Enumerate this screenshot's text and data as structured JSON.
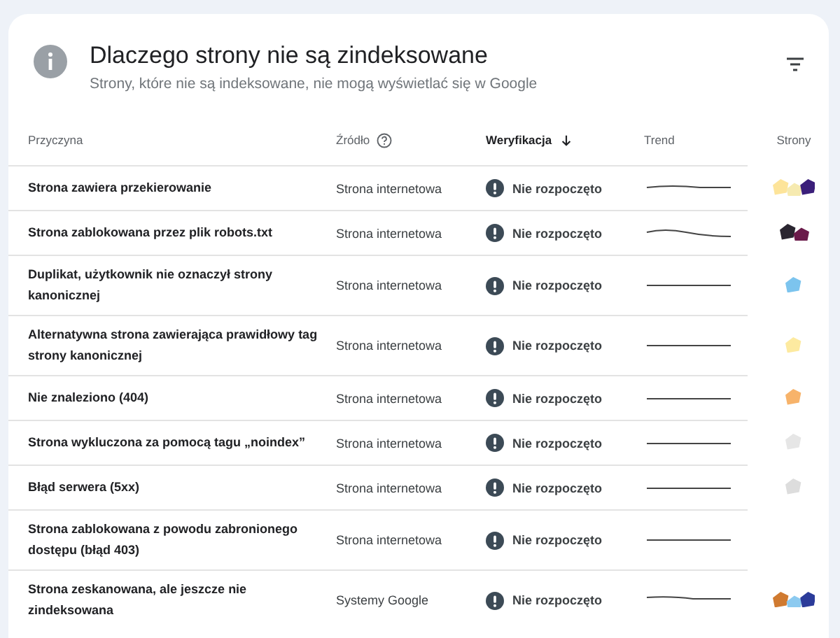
{
  "header": {
    "title": "Dlaczego strony nie są zindeksowane",
    "subtitle": "Strony, które nie są indeksowane, nie mogą wyświetlać się w Google"
  },
  "columns": [
    {
      "label": "Przyczyna",
      "sorted": false,
      "help": false
    },
    {
      "label": "Źródło",
      "sorted": false,
      "help": true
    },
    {
      "label": "Weryfikacja",
      "sorted": true,
      "help": false
    },
    {
      "label": "Trend",
      "sorted": false,
      "help": false
    },
    {
      "label": "Strony",
      "sorted": false,
      "help": false
    }
  ],
  "rows": [
    {
      "reason": "Strona zawiera przekierowanie",
      "source": "Strona internetowa",
      "verification": "Nie rozpoczęto"
    },
    {
      "reason": "Strona zablokowana przez plik robots.txt",
      "source": "Strona internetowa",
      "verification": "Nie rozpoczęto"
    },
    {
      "reason": "Duplikat, użytkownik nie oznaczył strony kanonicznej",
      "source": "Strona internetowa",
      "verification": "Nie rozpoczęto"
    },
    {
      "reason": "Alternatywna strona zawierająca prawidłowy tag strony kanonicznej",
      "source": "Strona internetowa",
      "verification": "Nie rozpoczęto"
    },
    {
      "reason": "Nie znaleziono (404)",
      "source": "Strona internetowa",
      "verification": "Nie rozpoczęto"
    },
    {
      "reason": "Strona wykluczona za pomocą tagu „noindex”",
      "source": "Strona internetowa",
      "verification": "Nie rozpoczęto"
    },
    {
      "reason": "Błąd serwera (5xx)",
      "source": "Strona internetowa",
      "verification": "Nie rozpoczęto"
    },
    {
      "reason": "Strona zablokowana z powodu zabronionego dostępu (błąd 403)",
      "source": "Strona internetowa",
      "verification": "Nie rozpoczęto"
    },
    {
      "reason": "Strona zeskanowana, ale jeszcze nie zindeksowana",
      "source": "Systemy Google",
      "verification": "Nie rozpoczęto"
    }
  ]
}
